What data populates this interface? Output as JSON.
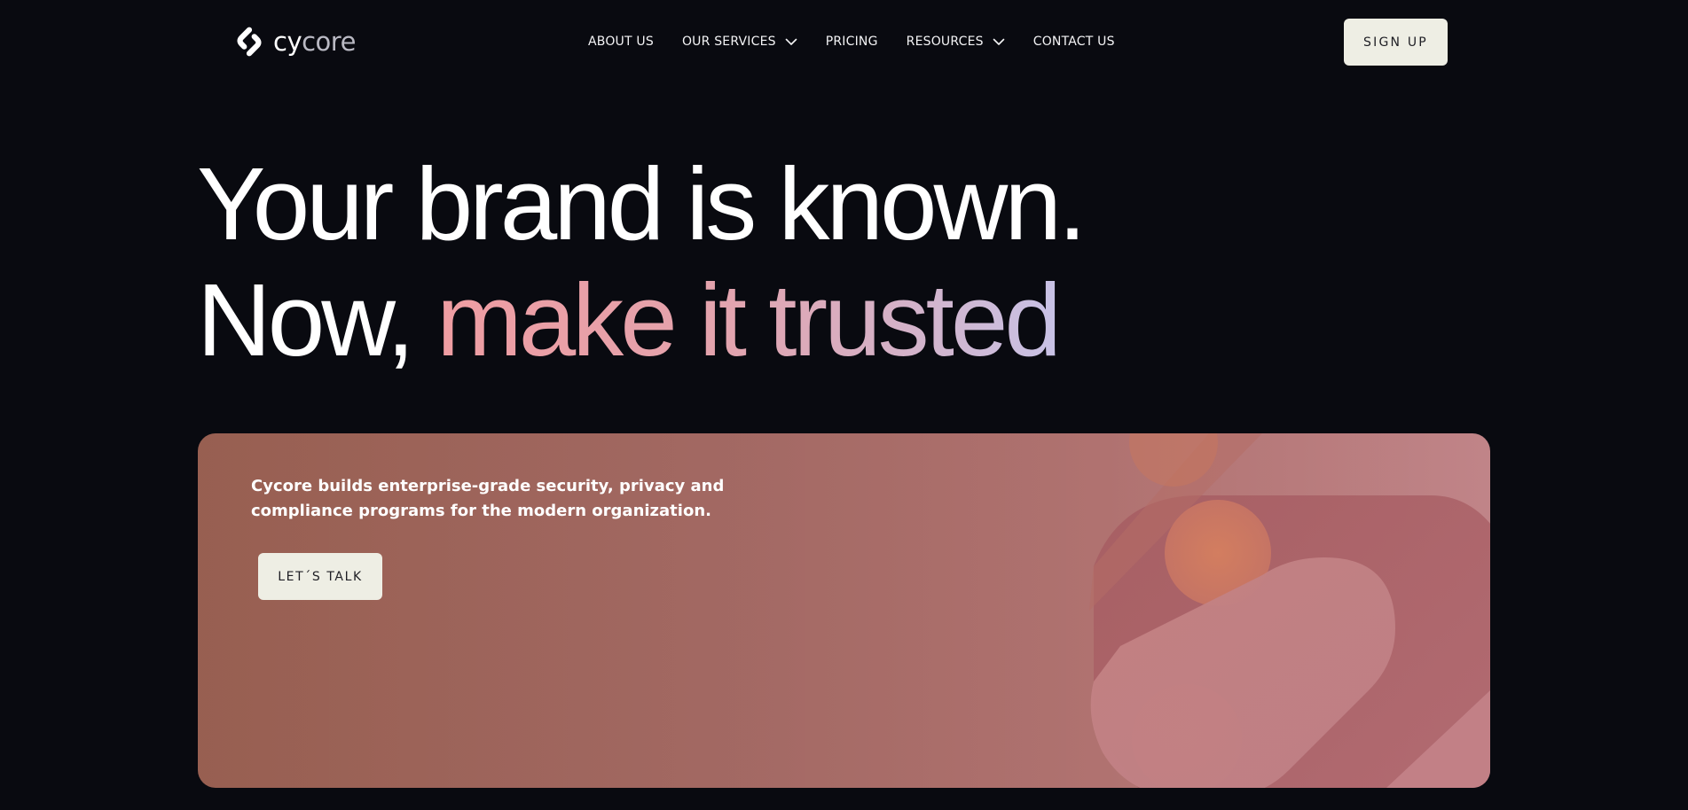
{
  "header": {
    "logo": {
      "text_part1": "cy",
      "text_part2": "core",
      "icon": "cycore-logo-icon"
    },
    "nav": [
      {
        "label": "ABOUT US",
        "has_dropdown": false
      },
      {
        "label": "OUR SERVICES",
        "has_dropdown": true
      },
      {
        "label": "PRICING",
        "has_dropdown": false
      },
      {
        "label": "RESOURCES",
        "has_dropdown": true
      },
      {
        "label": "CONTACT US",
        "has_dropdown": false
      }
    ],
    "signup_label": "SIGN UP"
  },
  "hero": {
    "line1": "Your brand is known.",
    "line2_plain": "Now, ",
    "line2_highlight": "make it trusted"
  },
  "banner": {
    "description": "Cycore builds enterprise-grade security, privacy and compliance programs for the modern organization.",
    "cta_label": "LET´S TALK"
  },
  "colors": {
    "background": "#090a10",
    "button_bg": "#eeeee4",
    "button_text": "#1e1e24",
    "highlight_gradient_start": "#ef9da2",
    "highlight_gradient_end": "#c8c2e6",
    "banner_gradient_start": "#a16556",
    "banner_gradient_end": "#c08488"
  }
}
